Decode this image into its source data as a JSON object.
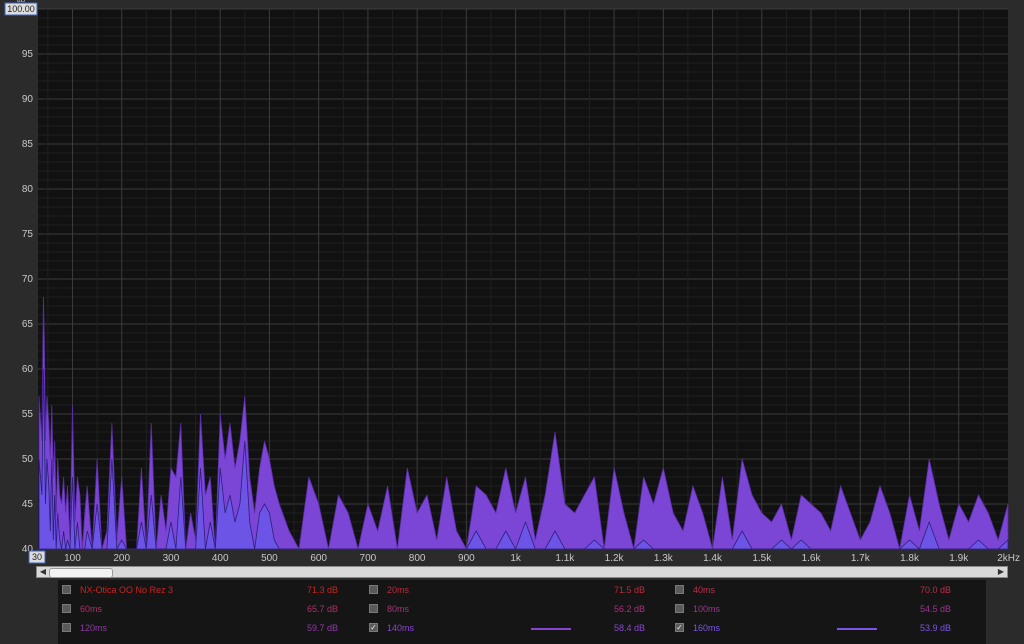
{
  "chart_data": {
    "type": "area",
    "ylabel": "dB",
    "y_max_box_label": "100.00",
    "x_min_box_label": "30",
    "ylim": [
      40,
      100
    ],
    "xlim": [
      30,
      2000
    ],
    "yticks": [
      95,
      90,
      85,
      80,
      75,
      70,
      65,
      60,
      55,
      50,
      45,
      40
    ],
    "xticks": [
      {
        "v": 100,
        "label": "100"
      },
      {
        "v": 200,
        "label": "200"
      },
      {
        "v": 300,
        "label": "300"
      },
      {
        "v": 400,
        "label": "400"
      },
      {
        "v": 500,
        "label": "500"
      },
      {
        "v": 600,
        "label": "600"
      },
      {
        "v": 700,
        "label": "700"
      },
      {
        "v": 800,
        "label": "800"
      },
      {
        "v": 900,
        "label": "900"
      },
      {
        "v": 1000,
        "label": "1k"
      },
      {
        "v": 1100,
        "label": "1.1k"
      },
      {
        "v": 1200,
        "label": "1.2k"
      },
      {
        "v": 1300,
        "label": "1.3k"
      },
      {
        "v": 1400,
        "label": "1.4k"
      },
      {
        "v": 1500,
        "label": "1.5k"
      },
      {
        "v": 1600,
        "label": "1.6k"
      },
      {
        "v": 1700,
        "label": "1.7k"
      },
      {
        "v": 1800,
        "label": "1.8k"
      },
      {
        "v": 1900,
        "label": "1.9k"
      },
      {
        "v": 2000,
        "label": "2kHz"
      }
    ],
    "grid": true,
    "series": [
      {
        "name": "140ms",
        "color": "#7b45d6",
        "x": [
          32,
          38,
          41,
          43,
          45,
          48,
          52,
          55,
          58,
          61,
          64,
          67,
          70,
          74,
          78,
          82,
          86,
          90,
          95,
          100,
          105,
          110,
          115,
          120,
          125,
          130,
          140,
          150,
          160,
          170,
          180,
          190,
          200,
          210,
          220,
          230,
          240,
          250,
          260,
          270,
          280,
          290,
          300,
          310,
          320,
          330,
          340,
          350,
          360,
          370,
          380,
          390,
          400,
          410,
          420,
          430,
          440,
          450,
          460,
          470,
          480,
          490,
          500,
          510,
          520,
          540,
          560,
          580,
          600,
          620,
          640,
          660,
          680,
          700,
          720,
          740,
          760,
          780,
          800,
          820,
          840,
          860,
          880,
          900,
          920,
          940,
          960,
          980,
          1000,
          1020,
          1040,
          1060,
          1080,
          1100,
          1120,
          1140,
          1160,
          1180,
          1200,
          1220,
          1240,
          1260,
          1280,
          1300,
          1320,
          1340,
          1360,
          1380,
          1400,
          1420,
          1440,
          1460,
          1480,
          1500,
          1520,
          1540,
          1560,
          1580,
          1600,
          1620,
          1640,
          1660,
          1680,
          1700,
          1720,
          1740,
          1760,
          1780,
          1800,
          1820,
          1840,
          1860,
          1880,
          1900,
          1920,
          1940,
          1960,
          1980,
          2000
        ],
        "values": [
          57,
          52,
          68,
          63,
          52,
          57,
          54,
          50,
          56,
          48,
          52,
          44,
          50,
          46,
          45,
          48,
          44,
          47,
          41,
          56,
          43,
          48,
          46,
          40,
          44,
          47,
          40,
          50,
          40,
          42,
          54,
          41,
          48,
          40,
          40,
          40,
          49,
          40,
          54,
          40,
          46,
          42,
          49,
          48,
          54,
          40,
          44,
          41,
          55,
          46,
          48,
          40,
          55,
          50,
          54,
          49,
          52,
          57,
          48,
          44,
          49,
          52,
          50,
          47,
          45,
          42,
          40,
          48,
          45,
          40,
          46,
          44,
          40,
          45,
          42,
          47,
          40,
          49,
          44,
          46,
          41,
          48,
          42,
          40,
          47,
          46,
          44,
          49,
          44,
          48,
          41,
          46,
          53,
          45,
          44,
          46,
          48,
          40,
          49,
          44,
          40,
          48,
          45,
          49,
          44,
          42,
          47,
          44,
          40,
          48,
          41,
          50,
          46,
          44,
          43,
          45,
          41,
          46,
          45,
          44,
          42,
          47,
          44,
          41,
          43,
          47,
          44,
          40,
          46,
          42,
          50,
          45,
          41,
          45,
          43,
          46,
          44,
          41,
          45
        ]
      },
      {
        "name": "160ms",
        "color": "#6a55e8",
        "x": [
          32,
          38,
          41,
          43,
          45,
          48,
          52,
          55,
          58,
          61,
          64,
          67,
          70,
          74,
          78,
          82,
          86,
          90,
          95,
          100,
          105,
          110,
          115,
          120,
          125,
          130,
          140,
          150,
          160,
          170,
          180,
          190,
          200,
          210,
          220,
          230,
          240,
          250,
          260,
          270,
          280,
          290,
          300,
          310,
          320,
          330,
          340,
          350,
          360,
          370,
          380,
          390,
          400,
          410,
          420,
          430,
          440,
          450,
          460,
          470,
          480,
          490,
          500,
          510,
          520,
          540,
          560,
          580,
          600,
          620,
          640,
          660,
          680,
          700,
          720,
          740,
          760,
          780,
          800,
          820,
          840,
          860,
          880,
          900,
          920,
          940,
          960,
          980,
          1000,
          1020,
          1040,
          1060,
          1080,
          1100,
          1120,
          1140,
          1160,
          1180,
          1200,
          1220,
          1240,
          1260,
          1280,
          1300,
          1320,
          1340,
          1360,
          1380,
          1400,
          1420,
          1440,
          1460,
          1480,
          1500,
          1520,
          1540,
          1560,
          1580,
          1600,
          1620,
          1640,
          1660,
          1680,
          1700,
          1720,
          1740,
          1760,
          1780,
          1800,
          1820,
          1840,
          1860,
          1880,
          1900,
          1920,
          1940,
          1960,
          1980,
          2000
        ],
        "values": [
          50,
          46,
          60,
          54,
          45,
          50,
          47,
          42,
          50,
          41,
          46,
          40,
          44,
          41,
          40,
          42,
          40,
          41,
          40,
          48,
          40,
          43,
          40,
          40,
          40,
          42,
          40,
          45,
          40,
          40,
          50,
          40,
          41,
          40,
          40,
          40,
          43,
          40,
          46,
          40,
          40,
          40,
          43,
          40,
          48,
          40,
          40,
          40,
          49,
          40,
          43,
          40,
          49,
          44,
          46,
          43,
          45,
          52,
          43,
          40,
          44,
          45,
          44,
          41,
          40,
          40,
          40,
          40,
          40,
          40,
          40,
          40,
          40,
          40,
          40,
          40,
          40,
          40,
          40,
          40,
          40,
          40,
          40,
          40,
          42,
          40,
          40,
          42,
          40,
          43,
          40,
          40,
          42,
          40,
          40,
          40,
          41,
          40,
          40,
          40,
          40,
          41,
          40,
          40,
          40,
          40,
          40,
          40,
          40,
          40,
          40,
          42,
          40,
          40,
          40,
          41,
          40,
          41,
          40,
          40,
          40,
          40,
          40,
          40,
          40,
          40,
          40,
          40,
          41,
          40,
          43,
          40,
          40,
          40,
          40,
          41,
          40,
          40,
          41
        ]
      }
    ]
  },
  "scrollbar": {
    "left_arrow": "◀",
    "right_arrow": "▶"
  },
  "legend": [
    {
      "name": "NX-Otica OO No Rez 3",
      "value": "71.3 dB",
      "checked": false,
      "color": "#cc2222",
      "line": false
    },
    {
      "name": "20ms",
      "value": "71.5 dB",
      "checked": false,
      "color": "#c0283a",
      "line": false
    },
    {
      "name": "40ms",
      "value": "70.0 dB",
      "checked": false,
      "color": "#bb2c4c",
      "line": false
    },
    {
      "name": "60ms",
      "value": "65.7 dB",
      "checked": false,
      "color": "#b02f63",
      "line": false
    },
    {
      "name": "80ms",
      "value": "56.2 dB",
      "checked": false,
      "color": "#a63277",
      "line": false
    },
    {
      "name": "100ms",
      "value": "54.5 dB",
      "checked": false,
      "color": "#9a368d",
      "line": false
    },
    {
      "name": "120ms",
      "value": "59.7 dB",
      "checked": false,
      "color": "#8e3aa4",
      "line": false
    },
    {
      "name": "140ms",
      "value": "58.4 dB",
      "checked": true,
      "color": "#8a44d4",
      "line": true
    },
    {
      "name": "160ms",
      "value": "53.9 dB",
      "checked": true,
      "color": "#7a55e6",
      "line": true
    }
  ]
}
